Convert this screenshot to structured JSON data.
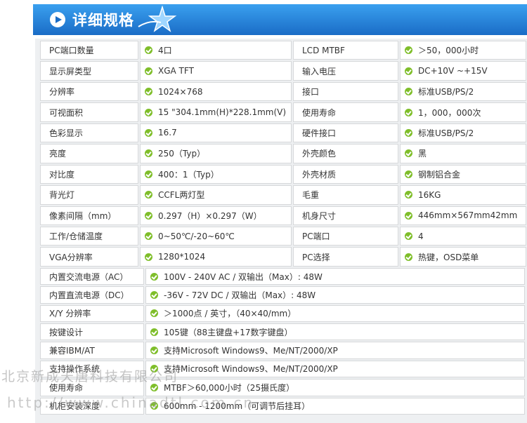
{
  "header": {
    "title": "详细规格"
  },
  "specs_pairs": [
    {
      "l1": "PC端口数量",
      "v1": "4口",
      "l2": "LCD MTBF",
      "v2": "＞50，000小时"
    },
    {
      "l1": "显示屏类型",
      "v1": "XGA  TFT",
      "l2": "输入电压",
      "v2": "DC+10V ~+15V"
    },
    {
      "l1": "分辨率",
      "v1": "1024×768",
      "l2": "接口",
      "v2": "标准USB/PS/2"
    },
    {
      "l1": "可视面积",
      "v1": "15 \"304.1mm(H)*228.1mm(V)",
      "l2": "使用寿命",
      "v2": "1，000，000次"
    },
    {
      "l1": "色彩显示",
      "v1": "16.7",
      "l2": "硬件接口",
      "v2": "标准USB/PS/2"
    },
    {
      "l1": "亮度",
      "v1": "250（Typ）",
      "l2": "外壳颜色",
      "v2": "黑"
    },
    {
      "l1": "对比度",
      "v1": "400：1（Typ）",
      "l2": "外壳材质",
      "v2": "钢制铝合金"
    },
    {
      "l1": "背光灯",
      "v1": "CCFL两灯型",
      "l2": "毛重",
      "v2": "16KG"
    },
    {
      "l1": "像素间隔（mm）",
      "v1": "0.297（H）×0.297（W）",
      "l2": "机身尺寸",
      "v2": "446mm×567mm42mm"
    },
    {
      "l1": "工作/仓储温度",
      "v1": "0~50℃/-20~60℃",
      "l2": "PC端口",
      "v2": "4"
    },
    {
      "l1": "VGA分辨率",
      "v1": "1280*1024",
      "l2": "PC选择",
      "v2": "热键，OSD菜单"
    }
  ],
  "specs_single": [
    {
      "l": "内置交流电源（AC）",
      "v": "100V - 240V AC / 双输出（Max）: 48W"
    },
    {
      "l": "内置直流电源（DC）",
      "v": "-36V - 72V DC / 双输出（Max）: 48W"
    },
    {
      "l": "X/Y 分辨率",
      "v": "＞1000点 / 英寸，（40×40/mm）"
    },
    {
      "l": "按键设计",
      "v": "105键（88主键盘+17数字键盘）"
    },
    {
      "l": "兼容IBM/AT",
      "v": "支持Microsoft Windows9、Me/NT/2000/XP"
    },
    {
      "l": "支持操作系统",
      "v": "支持Microsoft Windows9、Me/NT/2000/XP"
    },
    {
      "l": "使用寿命",
      "v": "MTBF＞60,000小时（25摄氏度）"
    },
    {
      "l": "机柜安装深度",
      "v": "600mm - 1200mm（可调节后挂耳）"
    }
  ],
  "watermark": {
    "line1": "北京新成天唐科技有限公司",
    "line2": "http://www.chinadtl.com.cn"
  },
  "colors": {
    "header_top": "#3aa0ef",
    "header_bottom": "#1a6cc6",
    "check": "#7fbe2a"
  }
}
